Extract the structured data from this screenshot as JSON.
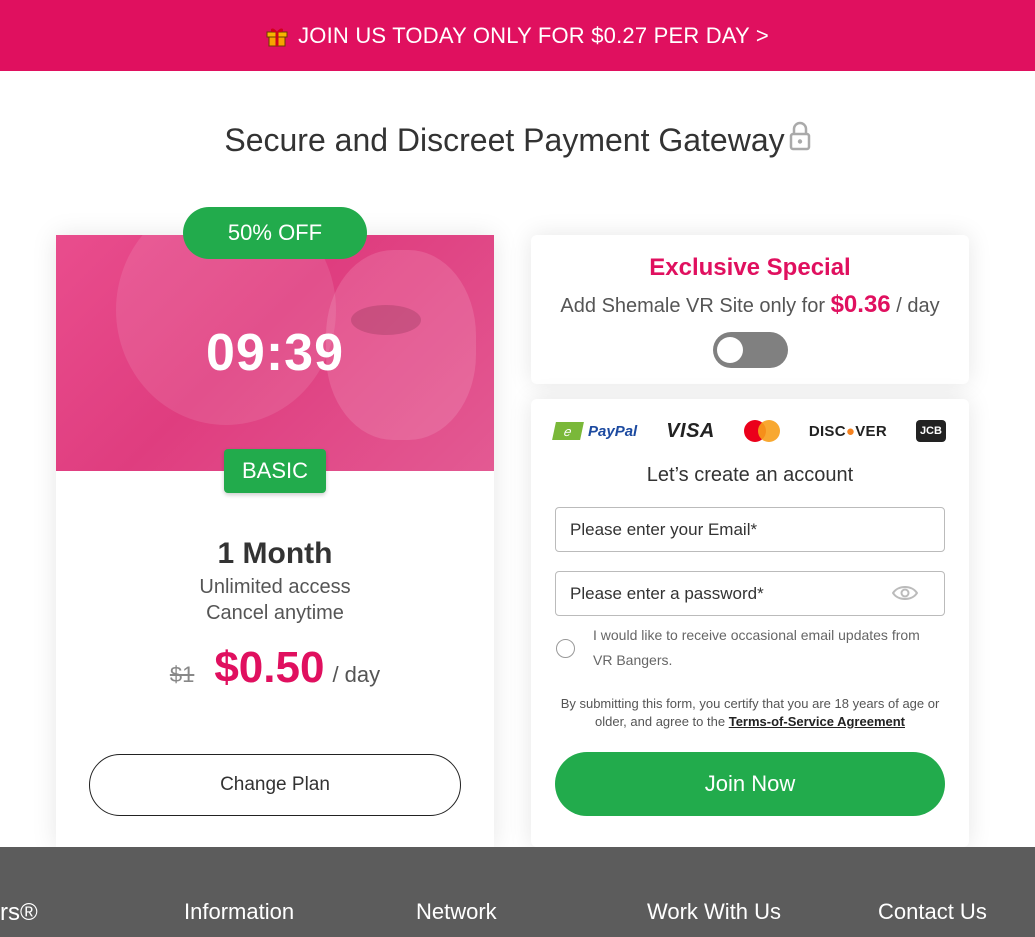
{
  "promo": {
    "text": "JOIN US TODAY ONLY FOR $0.27 PER DAY >",
    "icon": "gift-icon"
  },
  "page": {
    "title": "Secure and Discreet Payment Gateway",
    "title_icon": "lock-icon"
  },
  "plan": {
    "discount_badge": "50% OFF",
    "countdown": "09:39",
    "tier": "BASIC",
    "duration": "1 Month",
    "features": [
      "Unlimited access",
      "Cancel anytime"
    ],
    "old_price": "$1",
    "price": "$0.50",
    "price_unit": "/ day",
    "change_plan_label": "Change Plan"
  },
  "special": {
    "title": "Exclusive Special",
    "text_prefix": "Add Shemale VR Site only for",
    "price": "$0.36",
    "unit": "/ day",
    "toggle_on": false
  },
  "form": {
    "payment_methods": [
      "PayPal",
      "VISA",
      "mastercard",
      "DISCOVER",
      "JCB"
    ],
    "title": "Let’s create an account",
    "email_placeholder": "Please enter your Email*",
    "password_placeholder": "Please enter a password*",
    "newsletter_label": "I would like to receive occasional email updates from VR Bangers.",
    "disclaimer_text": "By submitting this form, you certify that you are 18 years of age or older, and agree to the",
    "tos_link": "Terms-of-Service Agreement",
    "submit_label": "Join Now"
  },
  "footer": {
    "logo_partial": "rs®",
    "headings": [
      "Information",
      "Network",
      "Work With Us",
      "Contact Us"
    ]
  },
  "colors": {
    "brand_pink": "#e0105f",
    "cta_green": "#22ab4c",
    "footer_gray": "#5c5c5c"
  }
}
